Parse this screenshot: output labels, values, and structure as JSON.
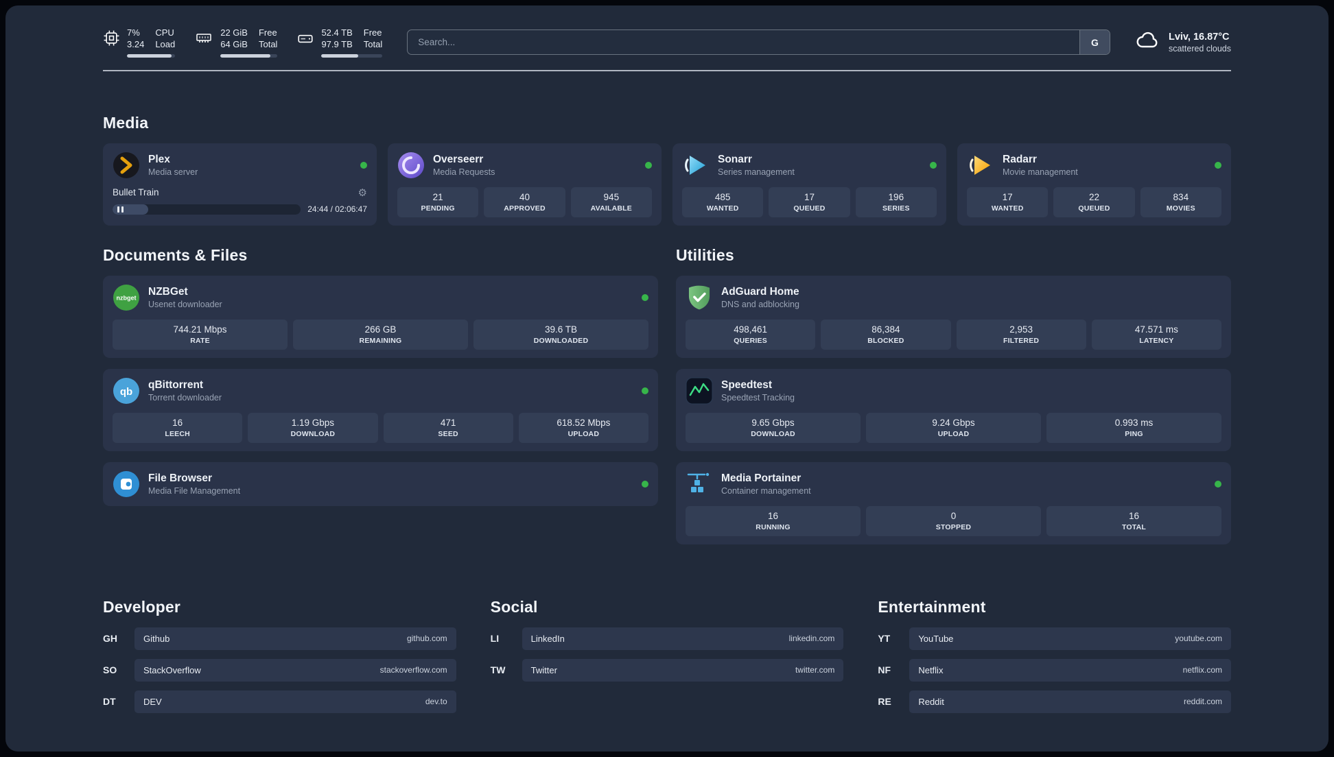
{
  "topbar": {
    "cpu": {
      "percent": "7%",
      "load": "3.24",
      "label1": "CPU",
      "label2": "Load",
      "bar_percent": 92
    },
    "ram": {
      "free": "22 GiB",
      "total": "64 GiB",
      "label1": "Free",
      "label2": "Total",
      "bar_percent": 88
    },
    "disk": {
      "free": "52.4 TB",
      "total": "97.9 TB",
      "label1": "Free",
      "label2": "Total",
      "bar_percent": 60
    },
    "search": {
      "placeholder": "Search...",
      "button_label": "G"
    },
    "weather": {
      "location": "Lviv, 16.87°C",
      "condition": "scattered clouds"
    }
  },
  "media": {
    "title": "Media",
    "plex": {
      "name": "Plex",
      "subtitle": "Media server",
      "now_playing": "Bullet Train",
      "time": "24:44 / 02:06:47",
      "progress_percent": 19
    },
    "overseerr": {
      "name": "Overseerr",
      "subtitle": "Media Requests",
      "stats": [
        {
          "value": "21",
          "label": "PENDING"
        },
        {
          "value": "40",
          "label": "APPROVED"
        },
        {
          "value": "945",
          "label": "AVAILABLE"
        }
      ]
    },
    "sonarr": {
      "name": "Sonarr",
      "subtitle": "Series management",
      "stats": [
        {
          "value": "485",
          "label": "WANTED"
        },
        {
          "value": "17",
          "label": "QUEUED"
        },
        {
          "value": "196",
          "label": "SERIES"
        }
      ]
    },
    "radarr": {
      "name": "Radarr",
      "subtitle": "Movie management",
      "stats": [
        {
          "value": "17",
          "label": "WANTED"
        },
        {
          "value": "22",
          "label": "QUEUED"
        },
        {
          "value": "834",
          "label": "MOVIES"
        }
      ]
    }
  },
  "documents": {
    "title": "Documents & Files",
    "nzbget": {
      "name": "NZBGet",
      "subtitle": "Usenet downloader",
      "icon_text": "nzbget",
      "stats": [
        {
          "value": "744.21 Mbps",
          "label": "RATE"
        },
        {
          "value": "266 GB",
          "label": "REMAINING"
        },
        {
          "value": "39.6 TB",
          "label": "DOWNLOADED"
        }
      ]
    },
    "qbittorrent": {
      "name": "qBittorrent",
      "subtitle": "Torrent downloader",
      "icon_text": "qb",
      "stats": [
        {
          "value": "16",
          "label": "LEECH"
        },
        {
          "value": "1.19 Gbps",
          "label": "DOWNLOAD"
        },
        {
          "value": "471",
          "label": "SEED"
        },
        {
          "value": "618.52 Mbps",
          "label": "UPLOAD"
        }
      ]
    },
    "filebrowser": {
      "name": "File Browser",
      "subtitle": "Media File Management"
    }
  },
  "utilities": {
    "title": "Utilities",
    "adguard": {
      "name": "AdGuard Home",
      "subtitle": "DNS and adblocking",
      "stats": [
        {
          "value": "498,461",
          "label": "QUERIES"
        },
        {
          "value": "86,384",
          "label": "BLOCKED"
        },
        {
          "value": "2,953",
          "label": "FILTERED"
        },
        {
          "value": "47.571 ms",
          "label": "LATENCY"
        }
      ]
    },
    "speedtest": {
      "name": "Speedtest",
      "subtitle": "Speedtest Tracking",
      "stats": [
        {
          "value": "9.65 Gbps",
          "label": "DOWNLOAD"
        },
        {
          "value": "9.24 Gbps",
          "label": "UPLOAD"
        },
        {
          "value": "0.993 ms",
          "label": "PING"
        }
      ]
    },
    "portainer": {
      "name": "Media Portainer",
      "subtitle": "Container management",
      "stats": [
        {
          "value": "16",
          "label": "RUNNING"
        },
        {
          "value": "0",
          "label": "STOPPED"
        },
        {
          "value": "16",
          "label": "TOTAL"
        }
      ]
    }
  },
  "bookmarks": {
    "developer": {
      "title": "Developer",
      "items": [
        {
          "abbr": "GH",
          "name": "Github",
          "url": "github.com"
        },
        {
          "abbr": "SO",
          "name": "StackOverflow",
          "url": "stackoverflow.com"
        },
        {
          "abbr": "DT",
          "name": "DEV",
          "url": "dev.to"
        }
      ]
    },
    "social": {
      "title": "Social",
      "items": [
        {
          "abbr": "LI",
          "name": "LinkedIn",
          "url": "linkedin.com"
        },
        {
          "abbr": "TW",
          "name": "Twitter",
          "url": "twitter.com"
        }
      ]
    },
    "entertainment": {
      "title": "Entertainment",
      "items": [
        {
          "abbr": "YT",
          "name": "YouTube",
          "url": "youtube.com"
        },
        {
          "abbr": "NF",
          "name": "Netflix",
          "url": "netflix.com"
        },
        {
          "abbr": "RE",
          "name": "Reddit",
          "url": "reddit.com"
        }
      ]
    }
  },
  "colors": {
    "status_online": "#37b54a",
    "accent_plex": "#e5a00d"
  }
}
